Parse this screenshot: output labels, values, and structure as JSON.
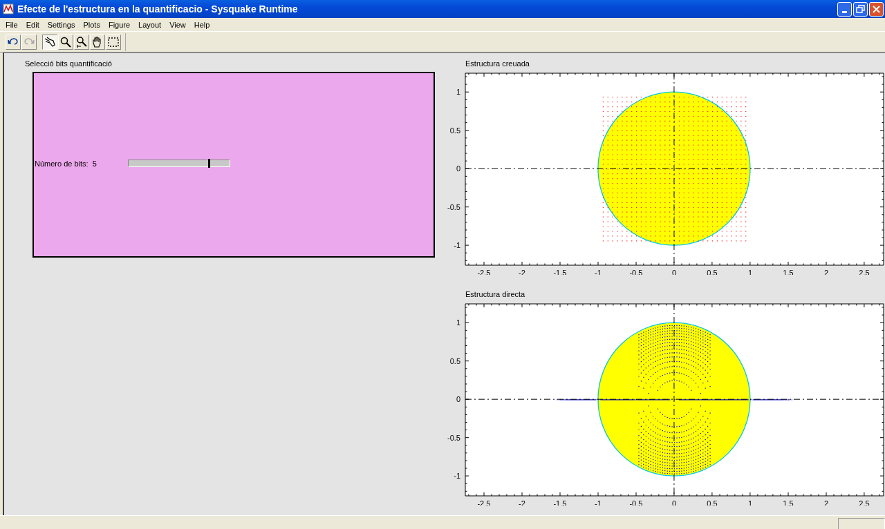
{
  "window": {
    "title": "Efecte de l'estructura en la quantificacio - Sysquake Runtime"
  },
  "menu": [
    "File",
    "Edit",
    "Settings",
    "Plots",
    "Figure",
    "Layout",
    "View",
    "Help"
  ],
  "toolbar": [
    {
      "kind": "undo",
      "disabled": false,
      "selected": false
    },
    {
      "kind": "redo",
      "disabled": true,
      "selected": false
    },
    {
      "kind": "manipulate",
      "disabled": false,
      "selected": true
    },
    {
      "kind": "zoom",
      "disabled": false,
      "selected": false
    },
    {
      "kind": "zoom-x",
      "disabled": false,
      "selected": false
    },
    {
      "kind": "pan",
      "disabled": false,
      "selected": false
    },
    {
      "kind": "select",
      "disabled": false,
      "selected": false
    }
  ],
  "settings_panel": {
    "title": "Selecció bits quantificació",
    "slider": {
      "label": "Número de bits:",
      "reading": "5",
      "level": 0.8
    }
  },
  "plots": [
    {
      "kind": "coupled",
      "chart_data": {
        "type": "scatter",
        "title": "Estructura creuada",
        "xlim": [
          -2.745,
          2.755
        ],
        "ylim": [
          -1.26,
          1.245
        ],
        "xticks": [
          -2.5,
          -2,
          -1.5,
          -1,
          -0.5,
          0,
          0.5,
          1,
          1.5,
          2,
          2.5
        ],
        "yticks": [
          -1,
          -0.5,
          0,
          0.5,
          1
        ]
      }
    },
    {
      "kind": "direct",
      "chart_data": {
        "type": "scatter",
        "title": "Estructura directa",
        "xlim": [
          -2.745,
          2.755
        ],
        "ylim": [
          -1.26,
          1.245
        ],
        "xticks": [
          -2.5,
          -2,
          -1.5,
          -1,
          -0.5,
          0,
          0.5,
          1,
          1.5,
          2,
          2.5
        ],
        "yticks": [
          -1,
          -0.5,
          0,
          0.5,
          1
        ]
      }
    }
  ]
}
